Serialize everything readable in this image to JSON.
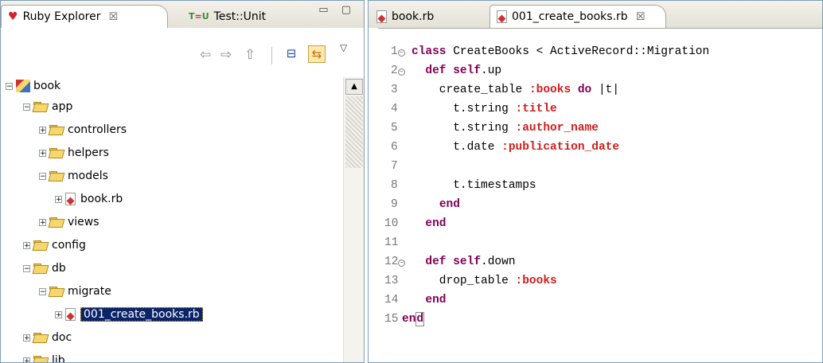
{
  "left_panel": {
    "tabs": [
      {
        "label": "Ruby Explorer",
        "close": "☒"
      },
      {
        "label": "Test::Unit"
      }
    ],
    "view_buttons": "▭ ▢"
  },
  "toolbar": {
    "back": "⇦",
    "forward": "⇨",
    "up": "⇧",
    "collapse": "⊟",
    "link": "⇆",
    "menu": "▽"
  },
  "tree": [
    {
      "label": "book",
      "expander": "−"
    },
    {
      "label": "app",
      "expander": "−"
    },
    {
      "label": "controllers",
      "expander": "+"
    },
    {
      "label": "helpers",
      "expander": "+"
    },
    {
      "label": "models",
      "expander": "−"
    },
    {
      "label": "book.rb",
      "expander": "+"
    },
    {
      "label": "views",
      "expander": "+"
    },
    {
      "label": "config",
      "expander": "+"
    },
    {
      "label": "db",
      "expander": "−"
    },
    {
      "label": "migrate",
      "expander": "−"
    },
    {
      "label": "001_create_books.rb",
      "expander": "+"
    },
    {
      "label": "doc",
      "expander": "+"
    },
    {
      "label": "lib",
      "expander": "+"
    }
  ],
  "editor": {
    "tabs": [
      {
        "label": "book.rb"
      },
      {
        "label": "001_create_books.rb",
        "close": "☒"
      }
    ],
    "line_numbers": [
      "1",
      "2",
      "3",
      "4",
      "5",
      "6",
      "7",
      "8",
      "9",
      "10",
      "11",
      "12",
      "13",
      "14",
      "15"
    ],
    "fold_marker": "−",
    "code": {
      "l1_kw": "class",
      "l1_rest": " CreateBooks < ActiveRecord::Migration",
      "l2_indent": "  ",
      "l2_kw1": "def",
      "l2_sp": " ",
      "l2_kw2": "self",
      "l2_rest": ".up",
      "l3_text": "    create_table ",
      "l3_sym": ":books",
      "l3_sp": " ",
      "l3_kw": "do",
      "l3_rest": " |t|",
      "l4_text": "      t.string ",
      "l4_sym": ":title",
      "l5_text": "      t.string ",
      "l5_sym": ":author_name",
      "l6_text": "      t.date ",
      "l6_sym": ":publication_date",
      "l8_text": "      t.timestamps",
      "l9_indent": "    ",
      "l9_kw": "end",
      "l10_indent": "  ",
      "l10_kw": "end",
      "l12_indent": "  ",
      "l12_kw1": "def",
      "l12_sp": " ",
      "l12_kw2": "self",
      "l12_rest": ".down",
      "l13_text": "    drop_table ",
      "l13_sym": ":books",
      "l14_indent": "  ",
      "l14_kw": "end",
      "l15_kw": "en",
      "l15_cursor": "d"
    }
  }
}
